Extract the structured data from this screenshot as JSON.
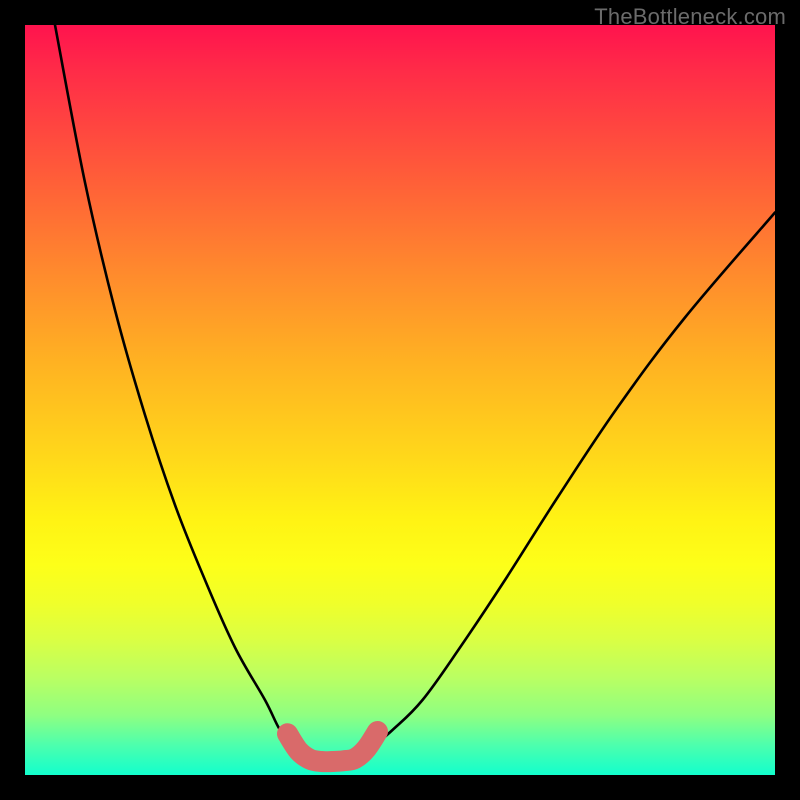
{
  "watermark": "TheBottleneck.com",
  "chart_data": {
    "type": "line",
    "title": "",
    "xlabel": "",
    "ylabel": "",
    "xlim": [
      0,
      100
    ],
    "ylim": [
      0,
      100
    ],
    "series": [
      {
        "name": "left-curve",
        "x": [
          4,
          8,
          12,
          16,
          20,
          24,
          28,
          32,
          34,
          36,
          37.5
        ],
        "y": [
          100,
          79,
          62,
          48,
          36,
          26,
          17,
          10,
          6,
          3.5,
          2
        ]
      },
      {
        "name": "right-curve",
        "x": [
          44,
          46,
          49,
          53,
          58,
          64,
          71,
          79,
          88,
          100
        ],
        "y": [
          2,
          3.5,
          6,
          10,
          17,
          26,
          37,
          49,
          61,
          75
        ]
      },
      {
        "name": "bottom-highlight",
        "x": [
          35,
          36.5,
          38,
          39.5,
          41,
          42.5,
          44,
          45.5,
          47
        ],
        "y": [
          5.5,
          3.2,
          2.1,
          1.8,
          1.8,
          1.9,
          2.2,
          3.5,
          5.8
        ]
      }
    ],
    "annotations": []
  }
}
